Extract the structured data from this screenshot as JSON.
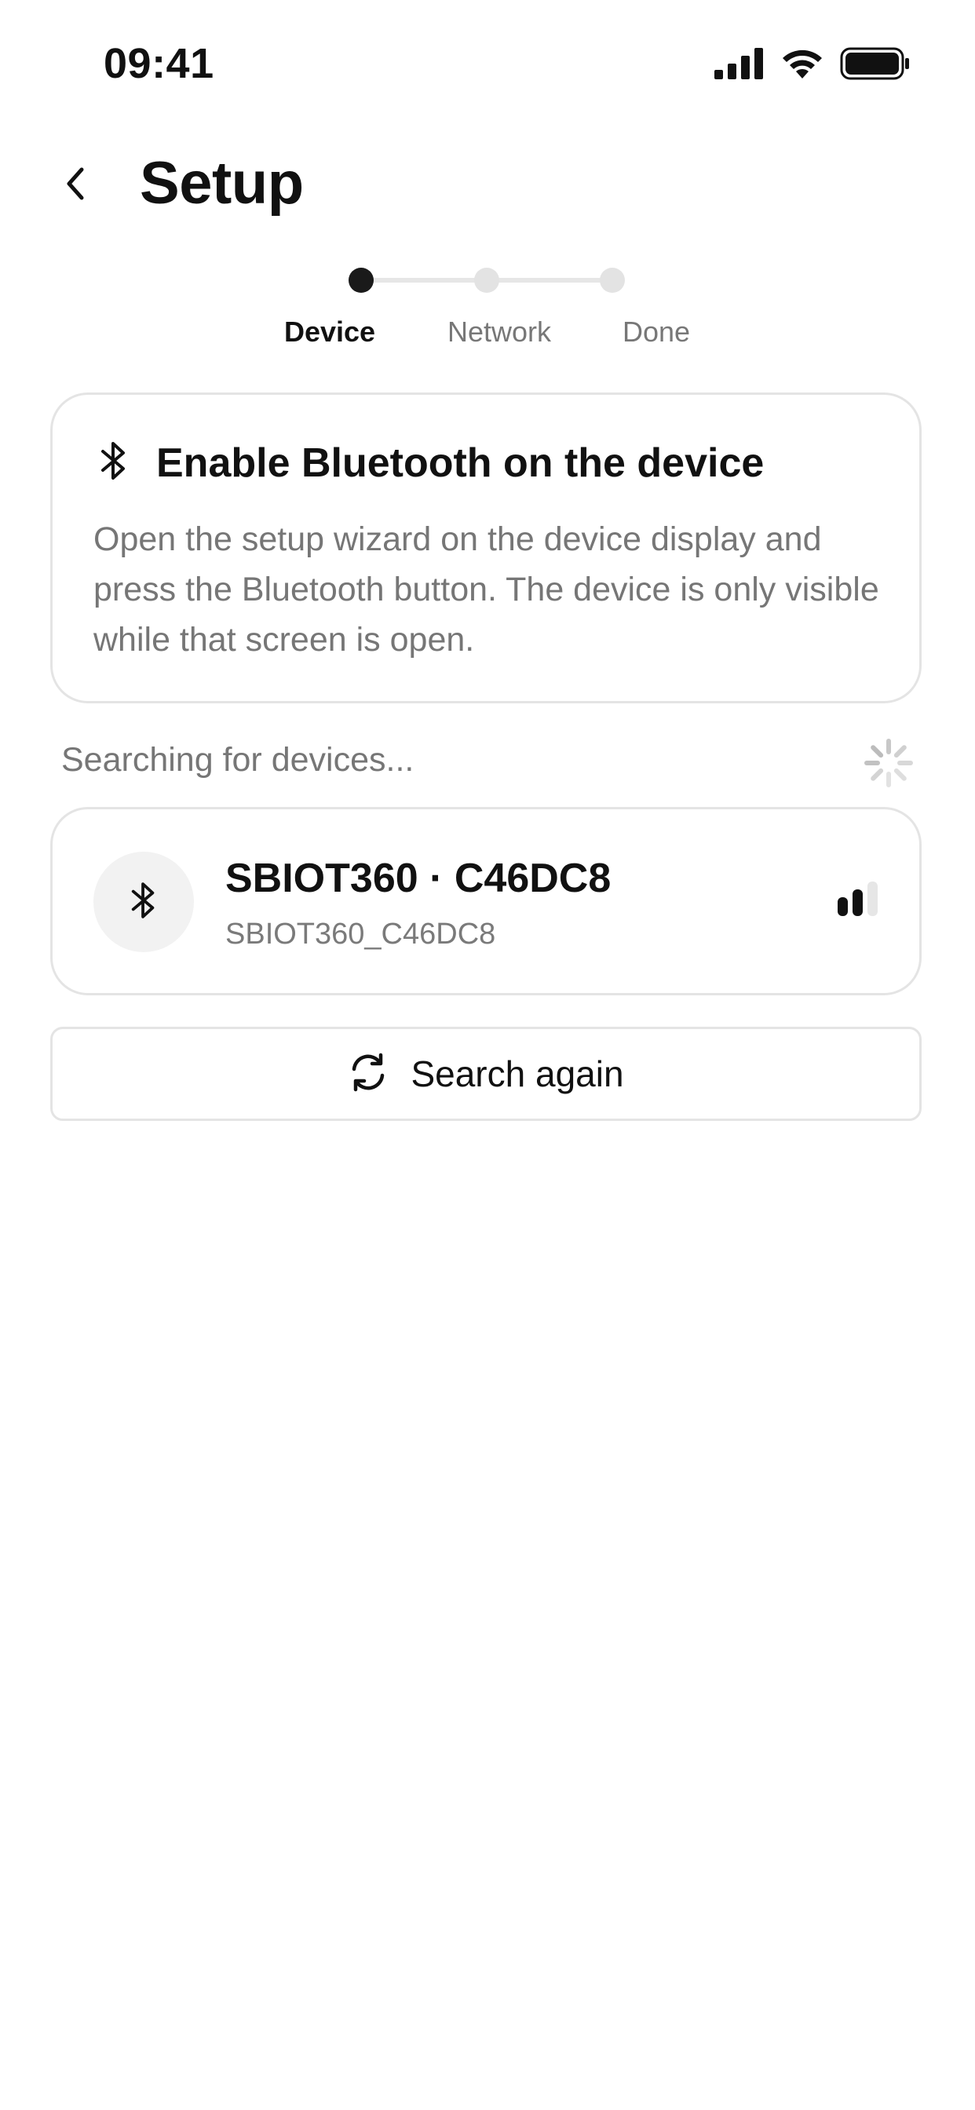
{
  "status_bar": {
    "time": "09:41",
    "icons": [
      "cellular-signal-icon",
      "wifi-icon",
      "battery-icon"
    ]
  },
  "header": {
    "back_icon": "chevron-left-icon",
    "title": "Setup"
  },
  "stepper": {
    "steps": [
      {
        "label": "Device",
        "state": "active"
      },
      {
        "label": "Network",
        "state": "inactive"
      },
      {
        "label": "Done",
        "state": "inactive"
      }
    ]
  },
  "info_card": {
    "icon": "bluetooth-icon",
    "title": "Enable Bluetooth on the device",
    "body": "Open the setup wizard on the device display and press the Bluetooth button. The device is only visible while that screen is open."
  },
  "search": {
    "status_text": "Searching for devices...",
    "spinner_icon": "loading-spinner-icon"
  },
  "devices": [
    {
      "icon": "bluetooth-icon",
      "name": "SBIOT360 · C46DC8",
      "id": "SBIOT360_C46DC8",
      "signal_bars": 2,
      "signal_max": 3
    }
  ],
  "search_again_button": {
    "icon": "refresh-icon",
    "label": "Search again"
  },
  "colors": {
    "text_primary": "#111111",
    "text_secondary": "#767676",
    "border": "#e4e4e4",
    "inactive_dot": "#e3e3e3",
    "avatar_bg": "#f2f2f2"
  }
}
